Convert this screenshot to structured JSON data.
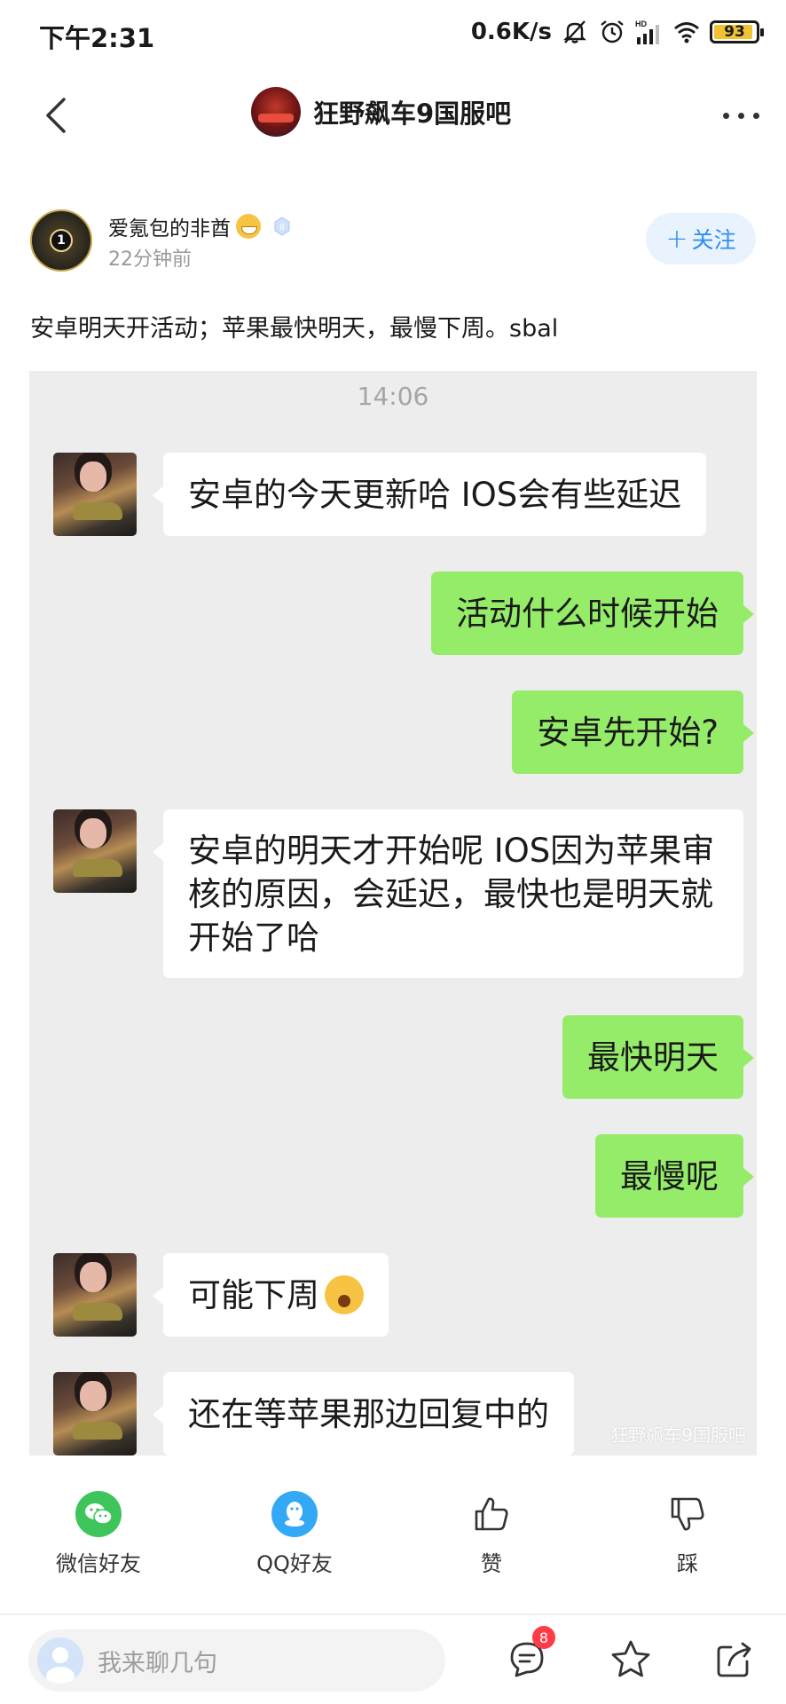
{
  "status_bar": {
    "time": "下午2:31",
    "net_speed": "0.6K/s",
    "battery": "93",
    "battery_level": 0.93,
    "battery_color": "#f1c232",
    "icons": [
      "mute-bell-icon",
      "alarm-icon",
      "hd-signal-icon",
      "wifi-icon",
      "battery-icon"
    ]
  },
  "nav": {
    "forum_name": "狂野飙车9国服吧"
  },
  "post": {
    "author_name": "爱氪包的非酋",
    "time_ago": "22分钟前",
    "follow_label": "关注",
    "follow_plus": "+",
    "text": "安卓明天开活动；苹果最快明天，最慢下周。sbal"
  },
  "chat": {
    "timestamp": "14:06",
    "watermark": "狂野飙车9国服吧",
    "messages": [
      {
        "side": "left",
        "text": "安卓的今天更新哈 IOS会有些延迟"
      },
      {
        "side": "right",
        "text": "活动什么时候开始"
      },
      {
        "side": "right",
        "text": "安卓先开始?"
      },
      {
        "side": "left",
        "text": "安卓的明天才开始呢  IOS因为苹果审核的原因，会延迟，最快也是明天就开始了哈"
      },
      {
        "side": "right",
        "text": "最快明天"
      },
      {
        "side": "right",
        "text": "最慢呢"
      },
      {
        "side": "left",
        "text": "可能下周",
        "emoji": "yawn-emoji"
      },
      {
        "side": "left",
        "text": "还在等苹果那边回复中的"
      }
    ],
    "colors": {
      "background": "#ededed",
      "left_bubble": "#ffffff",
      "right_bubble": "#95ec69"
    }
  },
  "actions": {
    "wechat": "微信好友",
    "qq": "QQ好友",
    "like": "赞",
    "dislike": "踩"
  },
  "bottom_bar": {
    "reply_placeholder": "我来聊几句",
    "comment_count": "8"
  },
  "colors": {
    "accent": "#2f8ef1",
    "wechat_green": "#3dc45a",
    "qq_blue": "#33a8f5",
    "badge_red": "#ff3b47"
  }
}
